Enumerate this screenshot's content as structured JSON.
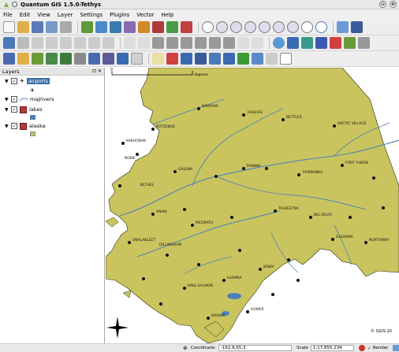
{
  "window": {
    "title": "Quantum GIS 1.5.0-Tethys",
    "minimize_icon": "minimize-icon",
    "close_icon": "close-icon"
  },
  "menu": [
    "File",
    "Edit",
    "View",
    "Layer",
    "Settings",
    "Plugins",
    "Vector",
    "Help"
  ],
  "layers_panel": {
    "title": "Layers",
    "layers": [
      {
        "name": "airports",
        "checked": true,
        "selected": true,
        "symbol": "airport-symbol-icon"
      },
      {
        "name": "majrivers",
        "checked": true,
        "selected": false,
        "symbol": "line-symbol-icon"
      },
      {
        "name": "lakes",
        "checked": true,
        "selected": false,
        "symbol": "polygon-layer-icon"
      },
      {
        "name": "alaska",
        "checked": true,
        "selected": false,
        "symbol": "polygon-layer-icon"
      }
    ]
  },
  "map": {
    "scale_label": "0",
    "scale_unit": "degrees",
    "land_color": "#c9c45e",
    "river_color": "#4c80bb",
    "copyright": "© QGIS 20",
    "north_arrow_icon": "north-arrow-icon",
    "places": [
      "KAKHONAK",
      "BETHEL",
      "DILLINGHAM",
      "FAIRBANKS",
      "NOME",
      "KOTZEBUE",
      "BARROW",
      "GALENA",
      "MCGRATH",
      "ANIAK",
      "KING SALMON",
      "TANANA",
      "ILIAMNA",
      "KENAI",
      "HOMER",
      "TALKEETNA",
      "BIG DELTA",
      "NORTHWAY",
      "GULKANA",
      "KODIAK",
      "UNALAKLEET",
      "HUGHES",
      "BETTLES",
      "FORT YUKON",
      "ARCTIC VILLAGE"
    ]
  },
  "status": {
    "coordinate_label": "Coordinate:",
    "coordinate_value": "-162.8,65.3",
    "scale_label": "Scale",
    "scale_value": "1:17,855,234",
    "render_label": "Render",
    "render_checked": true
  }
}
